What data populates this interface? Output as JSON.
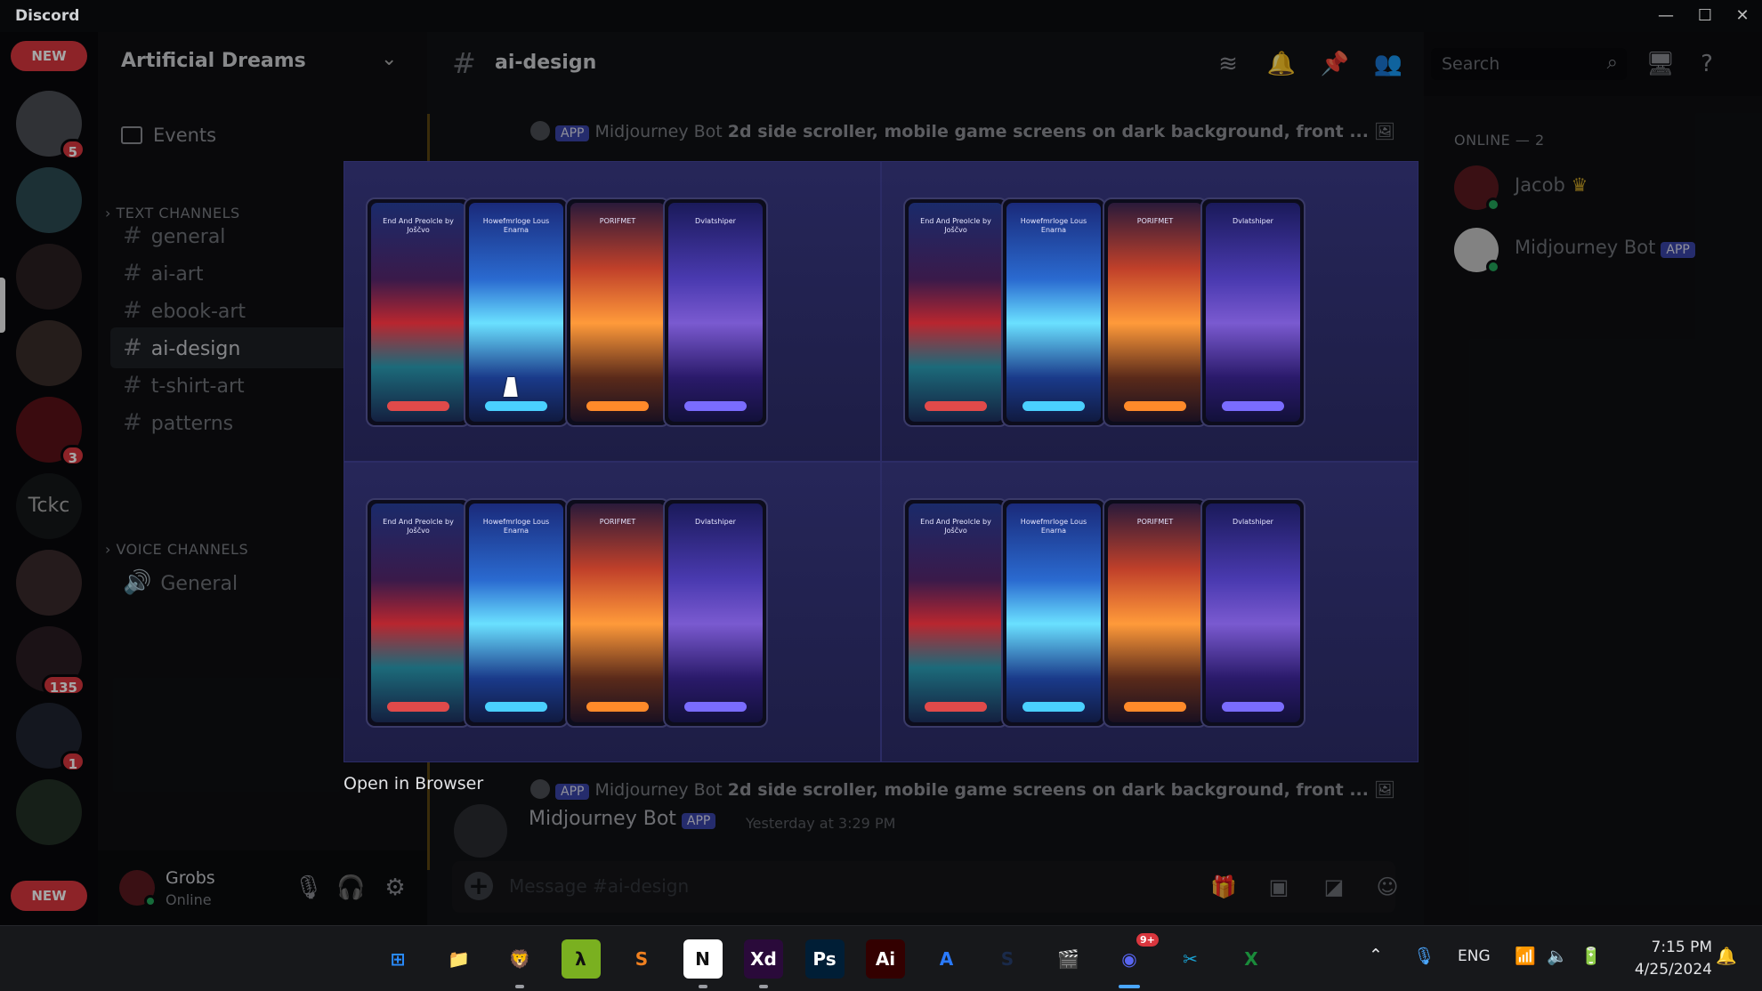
{
  "window": {
    "app_name": "Discord",
    "controls": [
      "minimize",
      "maximize",
      "close"
    ]
  },
  "server_rail": {
    "top_pill": "NEW",
    "bottom_pill": "NEW",
    "servers": [
      {
        "name": "server-1",
        "badge": "5"
      },
      {
        "name": "server-2",
        "badge": ""
      },
      {
        "name": "server-3",
        "badge": ""
      },
      {
        "name": "server-4",
        "badge": ""
      },
      {
        "name": "server-5",
        "badge": "3"
      },
      {
        "name": "Tckc",
        "badge": ""
      },
      {
        "name": "server-7",
        "badge": ""
      },
      {
        "name": "server-8",
        "badge": "135"
      },
      {
        "name": "server-9",
        "badge": "1"
      },
      {
        "name": "server-10",
        "badge": ""
      }
    ],
    "text_server_label": "Tckc"
  },
  "sidebar": {
    "guild_name": "Artificial Dreams",
    "events_label": "Events",
    "text_category": "TEXT CHANNELS",
    "voice_category": "VOICE CHANNELS",
    "text_channels": [
      "general",
      "ai-art",
      "ebook-art",
      "ai-design",
      "t-shirt-art",
      "patterns"
    ],
    "active_channel": "ai-design",
    "voice_channels": [
      "General"
    ]
  },
  "user": {
    "name": "Grobs",
    "status": "Online"
  },
  "header": {
    "channel": "ai-design",
    "search_placeholder": "Search"
  },
  "messages": {
    "reply_app_badge": "APP",
    "reply_author": "Midjourney Bot",
    "reply_prompt": "2d side scroller, mobile game screens on dark background, front ...",
    "author": "Midjourney Bot",
    "author_badge": "APP",
    "timestamp": "Yesterday at 3:29 PM",
    "composer_placeholder": "Message #ai-design"
  },
  "viewer": {
    "open_in_browser": "Open in Browser",
    "screens": [
      {
        "title": "End And Preolcle by Joščvo",
        "scene": "red-forest",
        "accent": "#e04a4a"
      },
      {
        "title": "Howefmrloge Lous Enarna",
        "scene": "ice-cave",
        "accent": "#4ad0ff"
      },
      {
        "title": "PORIFMET",
        "scene": "fire-canyon",
        "accent": "#ff8a2a"
      },
      {
        "title": "Dvlatshiper",
        "scene": "purple-valley",
        "accent": "#7a6cff"
      }
    ]
  },
  "members": {
    "online_header": "ONLINE — 2",
    "list": [
      {
        "name": "Jacob",
        "crown": "♛",
        "badge": ""
      },
      {
        "name": "Midjourney Bot",
        "crown": "",
        "badge": "APP"
      }
    ]
  },
  "taskbar": {
    "apps": [
      "Windows Start",
      "File Explorer",
      "Brave",
      "Lambda",
      "Sublime Text",
      "Notion",
      "Adobe XD",
      "Photoshop",
      "Illustrator",
      "App Store",
      "Steam",
      "Clapper",
      "Discord",
      "Capture",
      "Excel"
    ],
    "app_glyphs": [
      "⊞",
      "📁",
      "🦁",
      "λ",
      "S",
      "N",
      "Xd",
      "Ps",
      "Ai",
      "A",
      "S",
      "🎬",
      "◉",
      "✂",
      "X"
    ],
    "discord_badge": "9+",
    "language": "ENG",
    "time": "7:15 PM",
    "date": "4/25/2024"
  }
}
